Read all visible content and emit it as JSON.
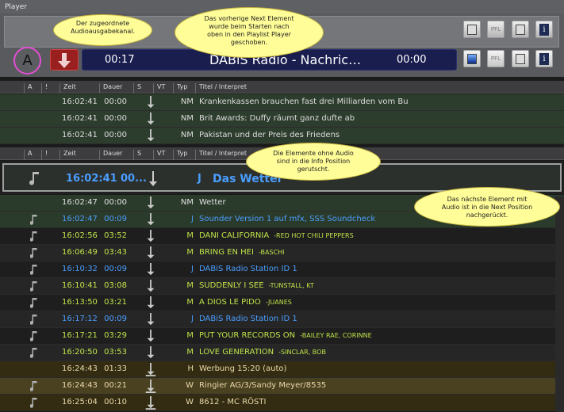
{
  "window": {
    "title": "Player"
  },
  "player": {
    "channel": "A",
    "now_start": "00:17",
    "now_title": "DABiS Radio - Nachric…",
    "now_remaining": "00:00",
    "pfl_label": "PFL"
  },
  "columns": [
    "A",
    "!",
    "Zeit",
    "Dauer",
    "S",
    "VT",
    "Typ",
    "Titel / Interpret"
  ],
  "columns2": [
    "A",
    "!",
    "Zeit",
    "Dauer",
    "S",
    "VT",
    "Typ",
    "Titel / Interpret"
  ],
  "history": [
    {
      "time": "16:02:41",
      "dur": "00:00",
      "typ": "NM",
      "title": "Krankenkassen brauchen fast drei Milliarden vom Bu"
    },
    {
      "time": "16:02:41",
      "dur": "00:00",
      "typ": "NM",
      "title": "Brit Awards: Duffy räumt ganz dufte ab"
    },
    {
      "time": "16:02:41",
      "dur": "00:00",
      "typ": "NM",
      "title": "Pakistan und der Preis des Friedens"
    }
  ],
  "next": {
    "time": "16:02:41",
    "dur": "00...",
    "typ": "J",
    "title": "Das Wetter"
  },
  "playlist": [
    {
      "time": "16:02:47",
      "dur": "00:00",
      "typ": "NM",
      "title": "Wetter",
      "artist": "",
      "color": "#e0e0e0",
      "bg": "#2b3b2b",
      "note": false,
      "arrow": "plain"
    },
    {
      "time": "16:02:47",
      "dur": "00:09",
      "typ": "J",
      "title": "Sounder Version 1 auf mfx, SSS Soundcheck",
      "artist": "",
      "color": "#4a9eff",
      "bg": "#2b3b2b",
      "note": true,
      "arrow": "plain"
    },
    {
      "time": "16:02:56",
      "dur": "03:52",
      "typ": "M",
      "title": "DANI CALIFORNIA",
      "artist": "-RED HOT CHILI PEPPERS",
      "color": "#bfe34a",
      "bg": "#1e1e1e",
      "note": true,
      "arrow": "plain"
    },
    {
      "time": "16:06:49",
      "dur": "03:43",
      "typ": "M",
      "title": "BRING EN HEI",
      "artist": "-BASCHI",
      "color": "#bfe34a",
      "bg": "#262626",
      "note": true,
      "arrow": "plain"
    },
    {
      "time": "16:10:32",
      "dur": "00:09",
      "typ": "J",
      "title": "DABiS Radio Station ID 1",
      "artist": "",
      "color": "#4a9eff",
      "bg": "#1e1e1e",
      "note": true,
      "arrow": "plain"
    },
    {
      "time": "16:10:41",
      "dur": "03:08",
      "typ": "M",
      "title": "SUDDENLY I SEE",
      "artist": "-TUNSTALL, KT",
      "color": "#bfe34a",
      "bg": "#262626",
      "note": true,
      "arrow": "plain"
    },
    {
      "time": "16:13:50",
      "dur": "03:21",
      "typ": "M",
      "title": "A DIOS LE PIDO",
      "artist": "-JUANES",
      "color": "#bfe34a",
      "bg": "#1e1e1e",
      "note": true,
      "arrow": "plain"
    },
    {
      "time": "16:17:12",
      "dur": "00:09",
      "typ": "J",
      "title": "DABiS Radio Station ID 1",
      "artist": "",
      "color": "#4a9eff",
      "bg": "#262626",
      "note": true,
      "arrow": "plain"
    },
    {
      "time": "16:17:21",
      "dur": "03:29",
      "typ": "M",
      "title": "PUT YOUR RECORDS ON",
      "artist": "-BAILEY RAE, CORINNE",
      "color": "#bfe34a",
      "bg": "#1e1e1e",
      "note": true,
      "arrow": "plain"
    },
    {
      "time": "16:20:50",
      "dur": "03:53",
      "typ": "M",
      "title": "LOVE GENERATION",
      "artist": "-SINCLAR, BOB",
      "color": "#bfe34a",
      "bg": "#262626",
      "note": true,
      "arrow": "plain"
    },
    {
      "time": "16:24:43",
      "dur": "01:33",
      "typ": "H",
      "title": "Werbung 15:20 (auto)",
      "artist": "",
      "color": "#e8d9a8",
      "bg": "#332c12",
      "note": false,
      "arrow": "bar"
    },
    {
      "time": "16:24:43",
      "dur": "00:21",
      "typ": "W",
      "title": "Ringier AG/3/Sandy Meyer/8535",
      "artist": "",
      "color": "#e8d9a8",
      "bg": "#4a4120",
      "note": true,
      "arrow": "bar"
    },
    {
      "time": "16:25:04",
      "dur": "00:10",
      "typ": "W",
      "title": "8612 - MC RÖSTI",
      "artist": "",
      "color": "#e8d9a8",
      "bg": "#332c12",
      "note": true,
      "arrow": "bar"
    }
  ],
  "callouts": {
    "c1": [
      "Der zugeordnete",
      "Audioausgabekanal."
    ],
    "c2": [
      "Das vorherige Next Element",
      "wurde beim Starten nach",
      "oben in den Playlist Player",
      "geschoben."
    ],
    "c3": [
      "Die Elemente ohne Audio",
      "sind in die Info Position",
      "gerutscht."
    ],
    "c4": [
      "Das nächste Element mit",
      "Audio ist in die Next Position",
      "nachgerückt."
    ]
  }
}
